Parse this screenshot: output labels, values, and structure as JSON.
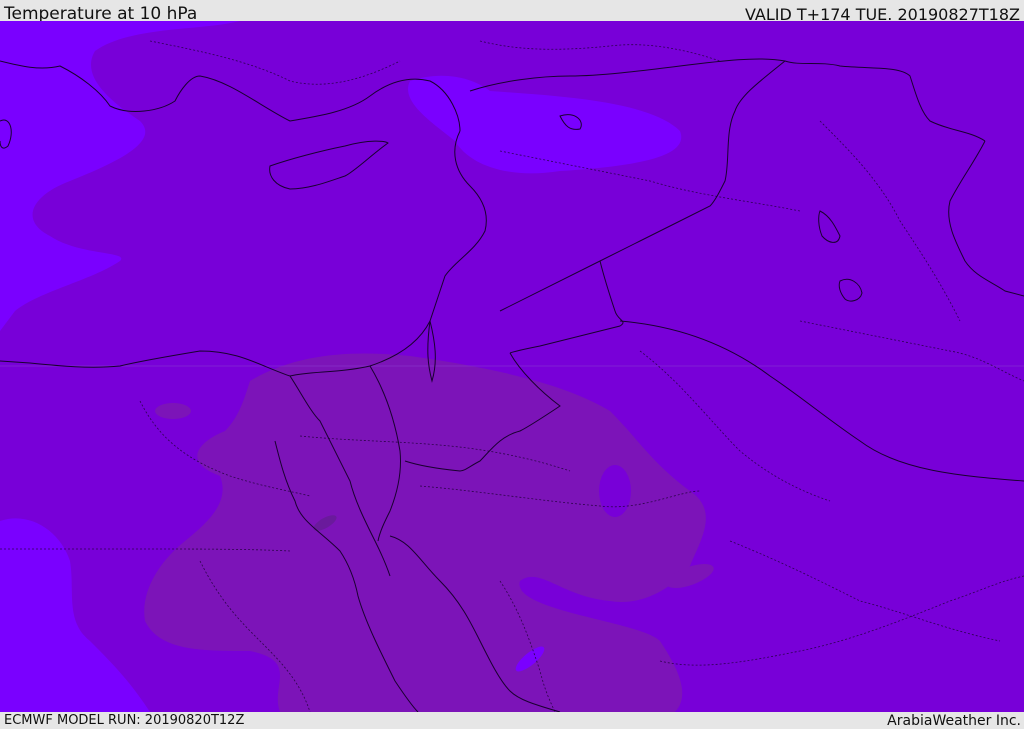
{
  "header": {
    "title": "Temperature at 10 hPa",
    "valid": "VALID T+174 TUE. 20190827T18Z"
  },
  "footer": {
    "model_run": "ECMWF MODEL RUN: 20190820T12Z",
    "credit": "ArabiaWeather Inc."
  },
  "colors": {
    "base": "#7800d8",
    "cold": "#7a00ff",
    "warm": "#7c14b8",
    "warmest": "#6a1a9c",
    "border": "#1a0030"
  }
}
